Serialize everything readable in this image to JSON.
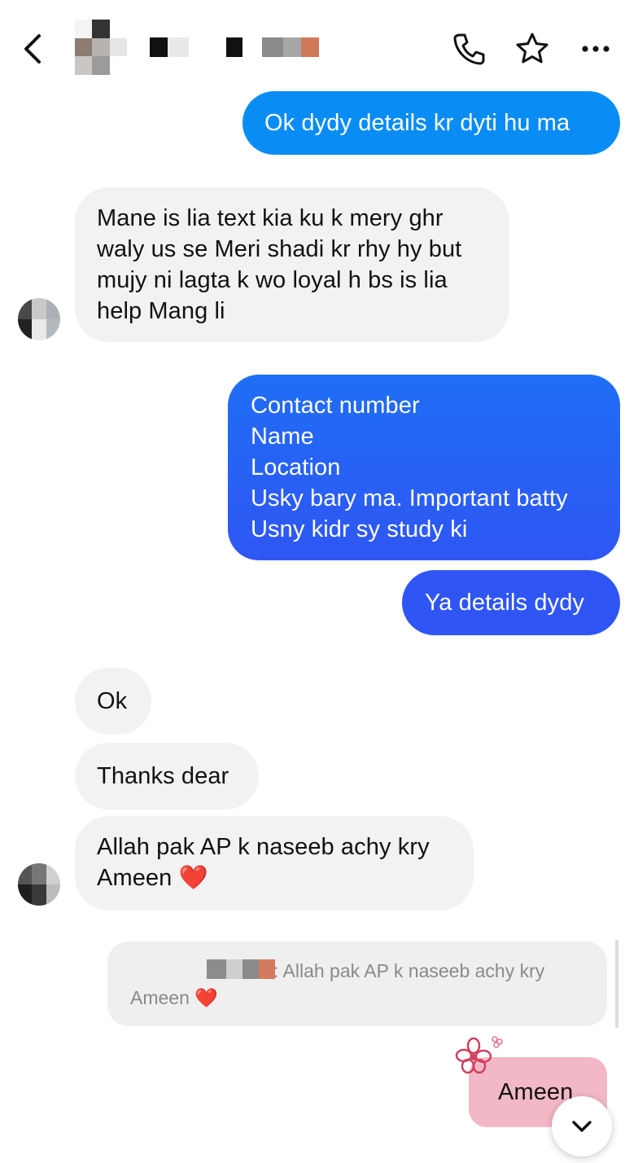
{
  "header": {
    "back_icon": "chevron-left-icon",
    "call_icon": "phone-icon",
    "favorite_icon": "star-icon",
    "more_icon": "more-horizontal-icon"
  },
  "messages": [
    {
      "direction": "outgoing",
      "text": "Ok dydy details kr dyti hu ma"
    },
    {
      "direction": "incoming",
      "text": "Mane is lia text kia ku k mery ghr\nwaly us se Meri shadi kr rhy hy but\nmujy ni lagta k wo loyal h bs is lia\nhelp Mang li"
    },
    {
      "direction": "outgoing",
      "text": "Contact number\nName\nLocation\nUsky bary ma. Important batty\nUsny kidr sy study ki"
    },
    {
      "direction": "outgoing",
      "text": "Ya details dydy"
    },
    {
      "direction": "incoming",
      "text": "Ok"
    },
    {
      "direction": "incoming",
      "text": "Thanks dear"
    },
    {
      "direction": "incoming",
      "text": "Allah pak AP k naseeb achy kry\nAmeen ❤️"
    },
    {
      "direction": "outgoing",
      "text": "Ameen"
    }
  ],
  "reply_preview": {
    "text_line1": ": Allah pak AP k naseeb achy kry",
    "text_line2": "Ameen ❤️"
  },
  "scroll_button_icon": "chevron-down-icon",
  "colors": {
    "outgoing_top": "#0a8cf5",
    "outgoing_bottom": "#2f56f4",
    "incoming_bg": "#f2f2f2",
    "ameen_bubble": "#f3b8c7",
    "flower": "#d0405f"
  }
}
